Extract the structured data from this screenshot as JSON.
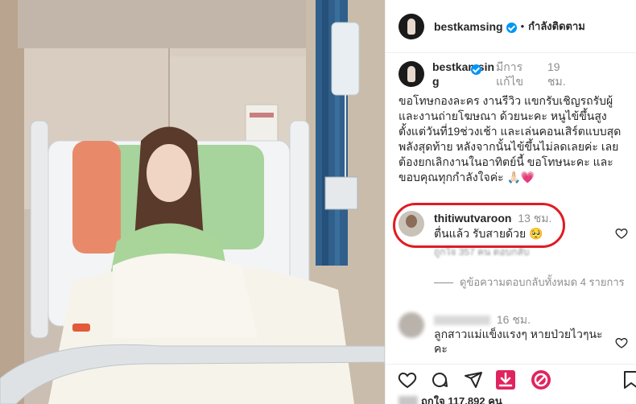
{
  "post": {
    "author": "bestkamsing",
    "follow_label": "กำลังติดตาม",
    "caption_author_line1": "bestkamsin",
    "caption_author_line2": "g",
    "edited_label": "มีการแก้ไข",
    "caption_time": "19 ชม.",
    "caption_text": "ขอโทษกองละคร งานรีวิว แขกรับเชิญรถรับผู้ และงานถ่ายโฆษณา ด้วยนะคะ หนูไข้ขึ้นสูงตั้งแต่วันที่19ช่วงเช้า และเล่นคอนเสิร์ตแบบสุดพลังสุดท้าย หลังจากนั้นไข้ขึ้นไม่ลดเลยค่ะ เลยต้องยกเลิกงานในอาทิตย์นี้ ขอโทษนะคะ และขอบคุณทุกกำลังใจค่ะ",
    "caption_emoji": "🙏🏻💗"
  },
  "comments": [
    {
      "username": "thitiwutvaroon",
      "time": "13 ชม.",
      "text": "ตื่นแล้ว รับสายด้วย 🥺",
      "meta": "ถูกใจ 357 คน  ตอบกลับ",
      "view_replies": "ดูข้อความตอบกลับทั้งหมด 4 รายการ"
    },
    {
      "username": "",
      "time": "16 ชม.",
      "text": "ลูกสาวแม่แข็งแรงๆ หายป่วยไวๆนะคะ"
    }
  ],
  "likes_text": "ถูกใจ 117,892 คน",
  "icons": [
    "heart-icon",
    "comment-icon",
    "share-icon",
    "download-icon",
    "block-icon",
    "bookmark-icon"
  ],
  "colors": {
    "verified": "#0095f6",
    "highlight": "#e11b22",
    "download": "#e0245e"
  }
}
